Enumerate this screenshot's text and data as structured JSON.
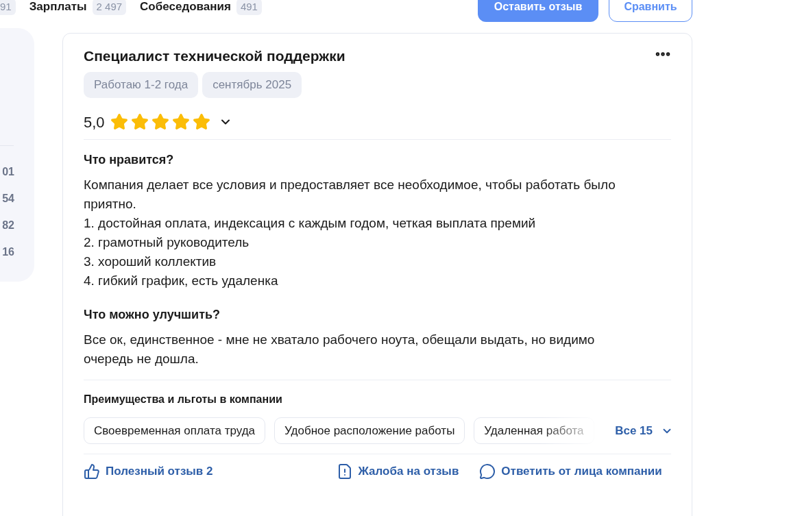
{
  "top_tabs": [
    {
      "count": "91"
    },
    {
      "label": "Зарплаты",
      "count": "2 497"
    },
    {
      "label": "Собеседования",
      "count": "491"
    }
  ],
  "top_buttons": [
    {
      "label": "Оставить отзыв",
      "kind": "primary"
    },
    {
      "label": "Сравнить",
      "kind": "outline"
    }
  ],
  "side_counts": [
    "01",
    "54",
    "82",
    "16"
  ],
  "review": {
    "title": "Специалист технической поддержки",
    "tags": [
      "Работаю 1-2 года",
      "сентябрь 2025"
    ],
    "rating": "5,0",
    "stars": 5,
    "sections": [
      {
        "title": "Что нравится?",
        "lines": [
          "Компания делает все условия и предоставляет все необходимое, чтобы работать было приятно.",
          "1. достойная оплата, индексация с каждым годом, четкая выплата премий",
          "2. грамотный руководитель",
          "3. хороший коллектив",
          "4. гибкий график, есть удаленка"
        ]
      },
      {
        "title": "Что можно улучшить?",
        "lines": [
          "Все ок, единственное - мне не хватало рабочего ноута, обещали выдать, но видимо очередь не дошла."
        ]
      }
    ],
    "benefits": {
      "title": "Преимущества и льготы в компании",
      "chips": [
        "Своевременная оплата труда",
        "Удобное расположение работы",
        "Удаленная работа"
      ],
      "more": "Все 15"
    },
    "actions": [
      {
        "label": "Полезный отзыв 2",
        "kind": "like"
      },
      {
        "label": "Жалоба на отзыв",
        "kind": "report"
      },
      {
        "label": "Ответить от лица компании",
        "kind": "reply"
      }
    ]
  }
}
